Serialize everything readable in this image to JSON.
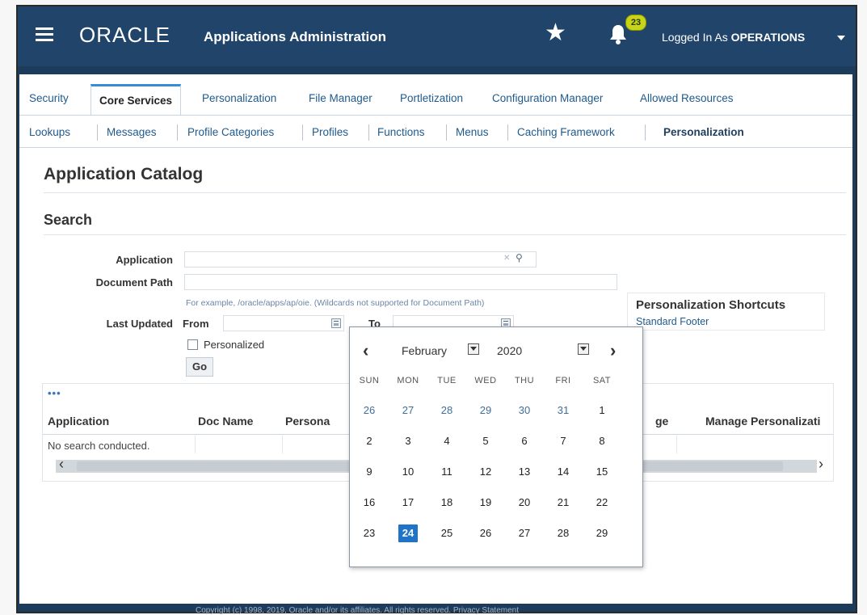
{
  "header": {
    "logo": "ORACLE",
    "app_title": "Applications Administration",
    "notification_count": "23",
    "login_prefix": "Logged In As ",
    "login_user": "OPERATIONS"
  },
  "tabs": [
    "Security",
    "Core Services",
    "Personalization",
    "File Manager",
    "Portletization",
    "Configuration Manager",
    "Allowed Resources"
  ],
  "subtabs": [
    "Lookups",
    "Messages",
    "Profile Categories",
    "Profiles",
    "Functions",
    "Menus",
    "Caching Framework",
    "Personalization"
  ],
  "page_title": "Application Catalog",
  "search": {
    "title": "Search",
    "application_label": "Application",
    "document_path_label": "Document Path",
    "hint": "For example, /oracle/apps/ap/oie. (Wildcards not supported for Document Path)",
    "last_updated_label": "Last Updated",
    "from_label": "From",
    "to_label": "To",
    "personalized_label": "Personalized",
    "go_label": "Go",
    "application_value": "",
    "document_path_value": "",
    "from_value": "",
    "to_value": ""
  },
  "shortcuts": {
    "title": "Personalization Shortcuts",
    "link": "Standard Footer"
  },
  "results": {
    "more": "•••",
    "columns": [
      "Application",
      "Doc Name",
      "Persona",
      "ge",
      "Manage Personalizati"
    ],
    "empty_text": "No search conducted."
  },
  "calendar": {
    "month": "February",
    "year": "2020",
    "weekdays": [
      "SUN",
      "MON",
      "TUE",
      "WED",
      "THU",
      "FRI",
      "SAT"
    ],
    "weeks": [
      [
        "26",
        "27",
        "28",
        "29",
        "30",
        "31",
        "1"
      ],
      [
        "2",
        "3",
        "4",
        "5",
        "6",
        "7",
        "8"
      ],
      [
        "9",
        "10",
        "11",
        "12",
        "13",
        "14",
        "15"
      ],
      [
        "16",
        "17",
        "18",
        "19",
        "20",
        "21",
        "22"
      ],
      [
        "23",
        "24",
        "25",
        "26",
        "27",
        "28",
        "29"
      ]
    ],
    "selected_day": "24"
  },
  "icons": {
    "menu": "hamburger-icon",
    "favorites": "star-icon",
    "notifications": "bell-icon",
    "user_menu": "chevron-down-icon",
    "search": "magnifier-icon",
    "date_picker": "calendar-icon"
  },
  "colors": {
    "header_bg": "#21456a",
    "link": "#1f5a8c",
    "active_tab_accent": "#3a8bd6",
    "badge": "#c7d41a",
    "selected_day": "#1f73c9"
  },
  "footer": "Copyright (c) 1998, 2019, Oracle and/or its affiliates. All rights reserved. Privacy Statement"
}
